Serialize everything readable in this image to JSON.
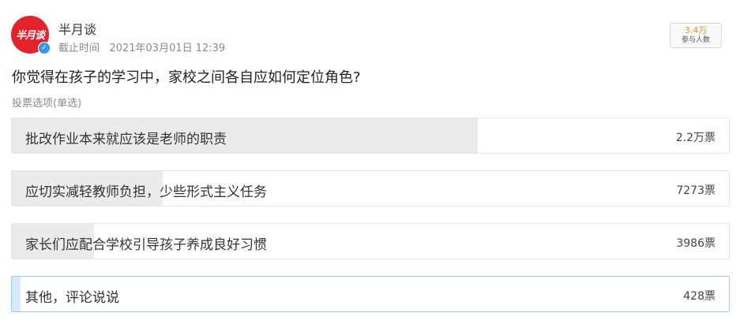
{
  "header": {
    "avatar_text": "半月谈",
    "verified_icon": "✓",
    "author_name": "半月谈",
    "deadline_label": "截止时间",
    "deadline_value": "2021年03月01日 12:39",
    "participants_count": "3.4万",
    "participants_label": "参与人数"
  },
  "poll": {
    "question": "你觉得在孩子的学习中，家校之间各自应如何定位角色?",
    "vote_type": "投票选项(单选)",
    "options": [
      {
        "label": "批改作业本来就应该是老师的职责",
        "votes": "2.2万票",
        "share": 0.65,
        "selected": false
      },
      {
        "label": "应切实减轻教师负担，少些形式主义任务",
        "votes": "7273票",
        "share": 0.21,
        "selected": false
      },
      {
        "label": "家长们应配合学校引导孩子养成良好习惯",
        "votes": "3986票",
        "share": 0.115,
        "selected": false
      },
      {
        "label": "其他，评论说说",
        "votes": "428票",
        "share": 0.012,
        "selected": true
      }
    ]
  },
  "colors": {
    "brand_red": "#e4222c",
    "accent_orange": "#f28c1e",
    "verified_blue": "#2f9ae8",
    "fill_gray": "#ebebeb",
    "selected_border": "#9fcdf0",
    "selected_fill": "#dbeaf8"
  }
}
